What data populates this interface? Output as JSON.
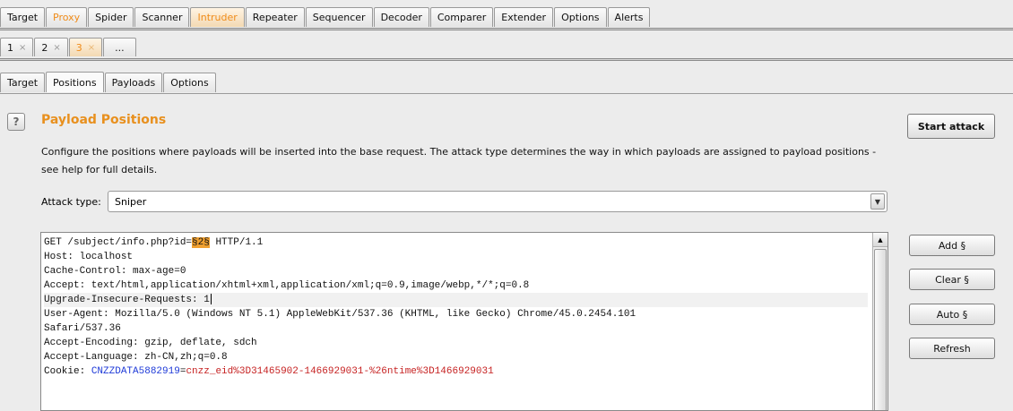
{
  "main_tabs": [
    "Target",
    "Proxy",
    "Spider",
    "Scanner",
    "Intruder",
    "Repeater",
    "Sequencer",
    "Decoder",
    "Comparer",
    "Extender",
    "Options",
    "Alerts"
  ],
  "sub_tabs": [
    "1",
    "2",
    "3",
    "..."
  ],
  "sub_tab_close": "×",
  "inner_tabs": [
    "Target",
    "Positions",
    "Payloads",
    "Options"
  ],
  "section": {
    "help_glyph": "?",
    "title": "Payload Positions",
    "description": "Configure the positions where payloads will be inserted into the base request. The attack type determines the way in which payloads are assigned to payload positions - see help for full details."
  },
  "attack": {
    "label": "Attack type:",
    "value": "Sniper"
  },
  "buttons": {
    "start_attack": "Start attack",
    "add": "Add §",
    "clear": "Clear §",
    "auto": "Auto §",
    "refresh": "Refresh"
  },
  "request": {
    "line1_pre": "GET /subject/info.php?id=",
    "line1_marker": "§2§",
    "line1_post": " HTTP/1.1",
    "host": "Host: localhost",
    "cache_control": "Cache-Control: max-age=0",
    "accept": "Accept: text/html,application/xhtml+xml,application/xml;q=0.9,image/webp,*/*;q=0.8",
    "upgrade": "Upgrade-Insecure-Requests: 1",
    "user_agent": "User-Agent: Mozilla/5.0 (Windows NT 5.1) AppleWebKit/537.36 (KHTML, like Gecko) Chrome/45.0.2454.101",
    "user_agent_cont": "Safari/537.36",
    "accept_encoding": "Accept-Encoding: gzip, deflate, sdch",
    "accept_language": "Accept-Language: zh-CN,zh;q=0.8",
    "cookie_label": "Cookie: ",
    "cookie_name": "CNZZDATA5882919",
    "cookie_eq": "=",
    "cookie_value": "cnzz_eid%3D31465902-1466929031-%26ntime%3D1466929031"
  },
  "colors": {
    "accent_orange": "#e8901e",
    "payload_marker": "#f0a030",
    "cookie_name": "#1f3bd8",
    "cookie_value": "#c62222"
  }
}
